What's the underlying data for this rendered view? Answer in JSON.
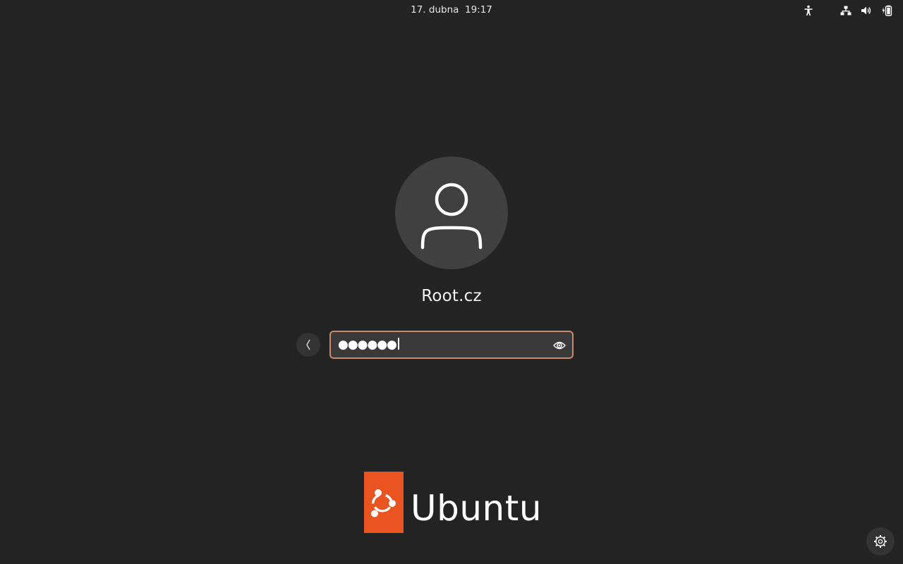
{
  "topbar": {
    "clock": "17. dubna  19:17",
    "icons": {
      "accessibility": "accessibility-icon",
      "network": "network-icon",
      "volume": "volume-icon",
      "battery": "battery-icon"
    }
  },
  "login": {
    "avatar_icon": "user-icon",
    "username": "Root.cz",
    "password": {
      "masked_value": "●●●●●●",
      "reveal_icon": "eye-icon"
    },
    "back_icon": "chevron-left-icon"
  },
  "branding": {
    "wordmark": "Ubuntu",
    "logo_icon": "ubuntu-circle-of-friends-icon",
    "accent_color": "#e95420",
    "focus_color": "#c88a6a"
  },
  "settings_icon": "gear-icon"
}
